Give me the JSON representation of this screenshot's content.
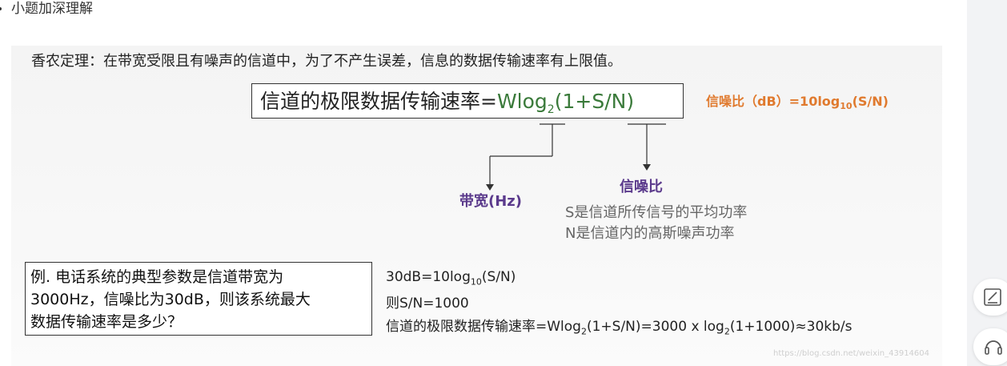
{
  "list_item": {
    "label": "小题加深理解"
  },
  "slide": {
    "title": "香农定理：在带宽受限且有噪声的信道中，为了不产生误差，信息的数据传输速率有上限值。",
    "formula": {
      "prefix": "信道的极限数据传输速率=",
      "w_log": "Wlog",
      "log_base": "2",
      "tail": "(1+S/N)"
    },
    "snr_def": {
      "prefix": "信噪比（dB）=10log",
      "base": "10",
      "tail": "(S/N)"
    },
    "bandwidth_label": "带宽(Hz)",
    "snr_label": "信噪比",
    "snr_desc_s": "S是信道所传信号的平均功率",
    "snr_desc_n": "N是信道内的高斯噪声功率",
    "question": {
      "line1": "例. 电话系统的典型参数是信道带宽为",
      "line2": "3000Hz，信噪比为30dB，则该系统最大",
      "line3": "数据传输速率是多少？"
    },
    "answer": {
      "line1_prefix": "30dB=10log",
      "line1_base": "10",
      "line1_tail": "(S/N)",
      "line2": "则S/N=1000",
      "line3_prefix": "信道的极限数据传输速率=Wlog",
      "line3_base1": "2",
      "line3_mid": "(1+S/N)=3000 x log",
      "line3_base2": "2",
      "line3_tail": "(1+1000)≈30kb/s"
    },
    "watermark": "https://blog.csdn.net/weixin_43914604"
  },
  "colors": {
    "green": "#3a7a3a",
    "orange": "#e07a2e",
    "purple": "#5b3a8c"
  },
  "sidebar_icons": [
    "edit-note-icon",
    "headset-icon"
  ]
}
